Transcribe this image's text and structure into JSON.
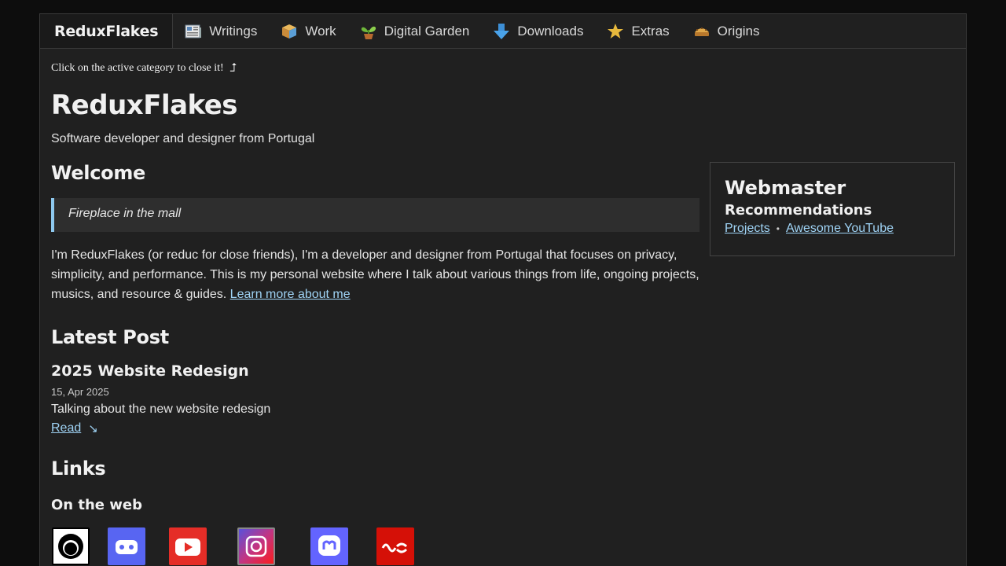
{
  "nav": {
    "brand": "ReduxFlakes",
    "items": [
      {
        "label": "Writings",
        "icon": "newspaper-icon"
      },
      {
        "label": "Work",
        "icon": "box-icon"
      },
      {
        "label": "Digital Garden",
        "icon": "plant-icon"
      },
      {
        "label": "Downloads",
        "icon": "download-arrow-icon"
      },
      {
        "label": "Extras",
        "icon": "star-icon"
      },
      {
        "label": "Origins",
        "icon": "pie-icon"
      }
    ]
  },
  "hint": {
    "text": "Click on the active category to close it!",
    "arrow": "⮥"
  },
  "site": {
    "title": "ReduxFlakes",
    "tagline": "Software developer and designer from Portugal"
  },
  "welcome": {
    "heading": "Welcome",
    "quote": "Fireplace in the mall",
    "intro": "I'm ReduxFlakes (or reduc for close friends), I'm a developer and designer from Portugal that focuses on privacy, simplicity, and performance. This is my personal website where I talk about various things from life, ongoing projects, musics, and resource & guides.",
    "learn_more": "Learn more about me"
  },
  "latest": {
    "heading": "Latest Post",
    "title": "2025 Website Redesign",
    "date": "15, Apr 2025",
    "desc": "Talking about the new website redesign",
    "read": "Read",
    "read_arrow": "↘"
  },
  "links": {
    "heading": "Links",
    "subheading": "On the web",
    "socials": [
      {
        "name": "github-icon",
        "color": "#ffffff"
      },
      {
        "name": "discord-icon",
        "color": "#5865f2"
      },
      {
        "name": "youtube-icon",
        "color": "#e52d27"
      },
      {
        "name": "instagram-icon",
        "color": "#c13584"
      },
      {
        "name": "mastodon-icon",
        "color": "#6364ff"
      },
      {
        "name": "lastfm-icon",
        "color": "#d51007"
      }
    ]
  },
  "webmaster": {
    "title": "Webmaster",
    "subtitle": "Recommendations",
    "links": [
      "Projects",
      "Awesome YouTube"
    ],
    "separator": "•"
  },
  "colors": {
    "accent": "#9fd3f5",
    "background": "#202020",
    "page": "#0d0d0d"
  }
}
